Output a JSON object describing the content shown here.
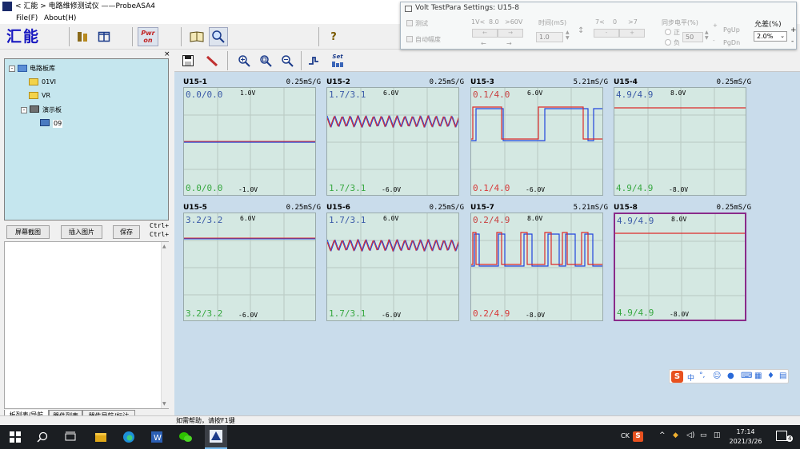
{
  "window": {
    "title": "< 汇能 > 电路维修测试仪 ——ProbeASA4"
  },
  "menu": {
    "file": "File(F)",
    "about": "About(H)"
  },
  "toolbar1": {
    "logo": "汇能",
    "pwr_label": "Pwr on"
  },
  "left_panel": {
    "close": "×",
    "tree": {
      "root": "电路板库",
      "items": [
        {
          "label": "01VI"
        },
        {
          "label": "VR"
        },
        {
          "label": "演示板"
        },
        {
          "label": "09"
        }
      ]
    },
    "buttons": {
      "screenshot": "屏幕截图",
      "insert_image": "插入图片",
      "save": "保存"
    },
    "shortcut1": "Ctrl+",
    "shortcut2": "Ctrl+",
    "tabs": [
      "板列表/导航",
      "器件列表",
      "器件导航/标注"
    ]
  },
  "toolbar2": {
    "set_label": "Set"
  },
  "channels": [
    {
      "name": "U15-1",
      "rate": "0.25mS/G",
      "top_ratio": "0.0/0.0",
      "bottom_ratio": "0.0/0.0",
      "vmax": "1.0V",
      "vmin": "-1.0V",
      "status": "pass"
    },
    {
      "name": "U15-2",
      "rate": "0.25mS/G",
      "top_ratio": "1.7/3.1",
      "bottom_ratio": "1.7/3.1",
      "vmax": "6.0V",
      "vmin": "-6.0V",
      "status": "pass"
    },
    {
      "name": "U15-3",
      "rate": "5.21mS/G",
      "top_ratio": "0.1/4.0",
      "bottom_ratio": "0.1/4.0",
      "vmax": "6.0V",
      "vmin": "-6.0V",
      "status": "fail"
    },
    {
      "name": "U15-4",
      "rate": "0.25mS/G",
      "top_ratio": "4.9/4.9",
      "bottom_ratio": "4.9/4.9",
      "vmax": "8.0V",
      "vmin": "-8.0V",
      "status": "pass"
    },
    {
      "name": "U15-5",
      "rate": "0.25mS/G",
      "top_ratio": "3.2/3.2",
      "bottom_ratio": "3.2/3.2",
      "vmax": "6.0V",
      "vmin": "-6.0V",
      "status": "pass"
    },
    {
      "name": "U15-6",
      "rate": "0.25mS/G",
      "top_ratio": "1.7/3.1",
      "bottom_ratio": "1.7/3.1",
      "vmax": "6.0V",
      "vmin": "-6.0V",
      "status": "pass"
    },
    {
      "name": "U15-7",
      "rate": "5.21mS/G",
      "top_ratio": "0.2/4.9",
      "bottom_ratio": "0.2/4.9",
      "vmax": "8.0V",
      "vmin": "-8.0V",
      "status": "fail"
    },
    {
      "name": "U15-8",
      "rate": "0.25mS/G",
      "top_ratio": "4.9/4.9",
      "bottom_ratio": "4.9/4.9",
      "vmax": "8.0V",
      "vmin": "-8.0V",
      "status": "pass",
      "selected": true
    }
  ],
  "status_bar": {
    "help": "如需帮助，请按F1键"
  },
  "dialog": {
    "title": "Volt TestPara Settings:   U15-8",
    "test_label": "测试",
    "auto_amp_label": "自动幅度",
    "range_labels": [
      "1V<",
      "8.0",
      ">60V"
    ],
    "time_label": "时间(mS)",
    "time_value": "1.0",
    "t_labels": [
      "7<",
      "0",
      ">7"
    ],
    "sync_label": "同步电平(%)",
    "pos_label": "正",
    "neg_label": "负",
    "sync_value": "50",
    "pgup": "PgUp",
    "pgdn": "PgDn",
    "tolerance_label": "允差(%)",
    "tolerance_value": "2.0%"
  },
  "taskbar": {
    "ime_lang": "CK",
    "time": "17:14",
    "date": "2021/3/26",
    "notif_count": "4"
  },
  "ime_bar": {
    "lang": "中"
  },
  "colors": {
    "plot_bg": "#d4e8e2",
    "ref_trace": "#2244dd",
    "test_trace": "#dd2a2a",
    "main_bg": "#c9dceb",
    "selected_border": "#8a2b8a"
  }
}
